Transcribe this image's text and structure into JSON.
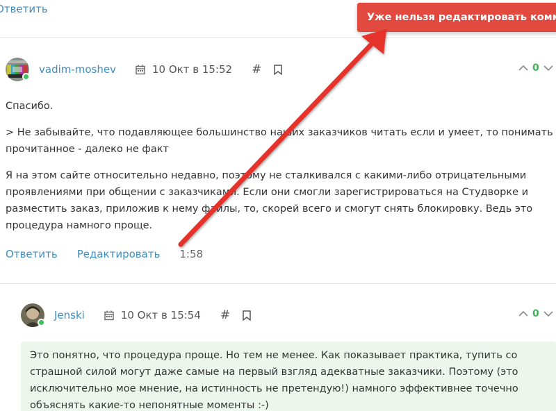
{
  "top": {
    "reply_label": "Ответить"
  },
  "toast": {
    "message": "Уже нельзя редактировать комментарий"
  },
  "comment1": {
    "username": "vadim-moshev",
    "date": "10 Окт в 15:52",
    "hash_label": "#",
    "votes": "0",
    "paragraphs": [
      "Спасибо.",
      "> Не забывайте, что подавляющее большинство наших заказчиков читать если и умеет, то понимать прочитанное - далеко не факт",
      "Я на этом сайте относительно недавно, поэтому не сталкивался с какими-либо отрицательными проявлениями при общении с заказчиками. Если они смогли зарегистрироваться на Студворке и разместить заказ, приложив к нему файлы, то, скорей всего и смогут снять блокировку. Ведь это процедура намного проще."
    ],
    "reply_label": "Ответить",
    "edit_label": "Редактировать",
    "timer": "1:58"
  },
  "comment2": {
    "username": "Jenski",
    "date": "10 Окт в 15:54",
    "hash_label": "#",
    "votes": "0",
    "text": "Это понятно, что процедура проще. Но тем не менее. Как показывает практика, тупить со страшной силой могут даже самые на первый взгляд адекватные заказчики. Поэтому (это исключительно мое мнение, на истинность не претендую!) намного эффективнее точечно объяснять какие-то непонятные моменты :-)"
  },
  "colors": {
    "link": "#3f8fc4",
    "vote_count": "#3fb356",
    "toast_bg": "#e34a3f",
    "arrow": "#e5332a",
    "highlight_bg": "#ecf6ec"
  }
}
